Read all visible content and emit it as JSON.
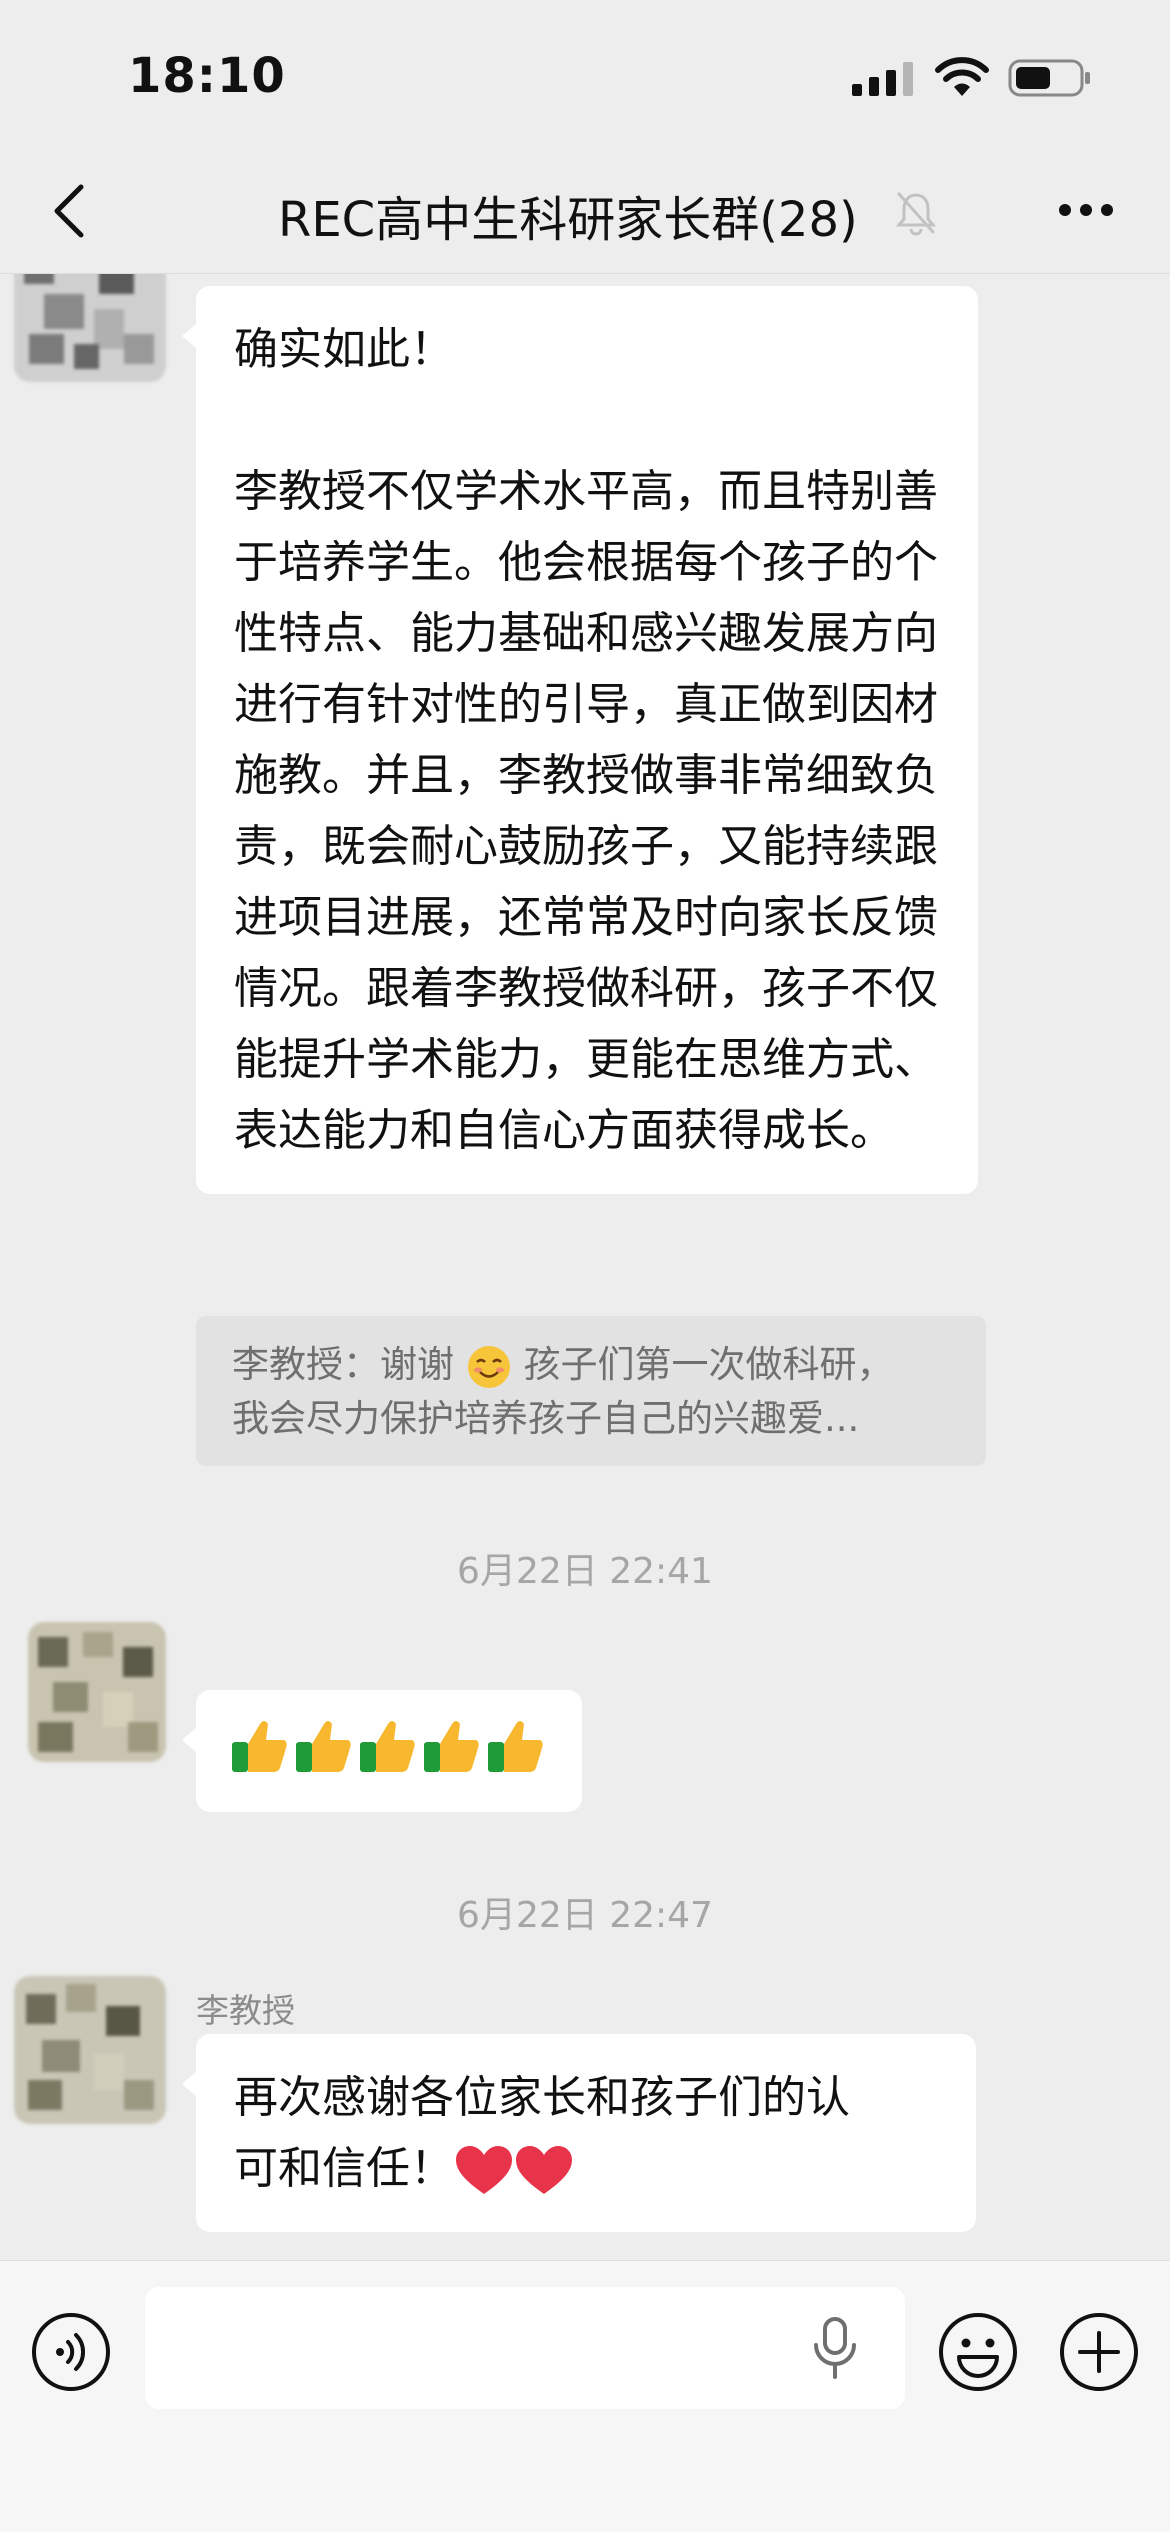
{
  "status_bar": {
    "time": "18:10"
  },
  "header": {
    "title": "REC高中生科研家长群(28)"
  },
  "messages": [
    {
      "id": "msg1",
      "paragraphs": [
        "确实如此！",
        "李教授不仅学术水平高，而且特别善于培养学生。他会根据每个孩子的个性特点、能力基础和感兴趣发展方向进行有针对性的引导，真正做到因材施教。并且，李教授做事非常细致负责，既会耐心鼓励孩子，又能持续跟进项目进展，还常常及时向家长反馈情况。跟着李教授做科研，孩子不仅能提升学术能力，更能在思维方式、表达能力和自信心方面获得成长。"
      ],
      "quote": {
        "line1_before": "李教授：谢谢",
        "line1_after": " 孩子们第一次做科研，",
        "line2": "我会尽力保护培养孩子自己的兴趣爱..."
      }
    },
    {
      "id": "ts1",
      "timestamp": "6月22日 22:41"
    },
    {
      "id": "msg2",
      "emoji": [
        "thumbs-up",
        "thumbs-up",
        "thumbs-up",
        "thumbs-up",
        "thumbs-up"
      ]
    },
    {
      "id": "ts2",
      "timestamp": "6月22日 22:47"
    },
    {
      "id": "msg3",
      "sender": "李教授",
      "text_line1": "再次感谢各位家长和孩子们的认",
      "text_line2": "可和信任！",
      "emoji": [
        "heart",
        "heart"
      ]
    }
  ],
  "colors": {
    "background": "#ededed",
    "bubble": "#ffffff",
    "quote_bg": "#e2e2e2",
    "timestamp_text": "#a6a6a6",
    "heart": "#e8344a",
    "thumb_yellow": "#f7b72f",
    "cuff_green": "#1f9b3a"
  },
  "icons": {
    "back": "chevron-left-icon",
    "mute": "bell-slash-icon",
    "more": "more-dots-icon",
    "voice": "voice-wave-icon",
    "mic": "microphone-icon",
    "emoji": "smiley-icon",
    "plus": "plus-circle-icon"
  }
}
